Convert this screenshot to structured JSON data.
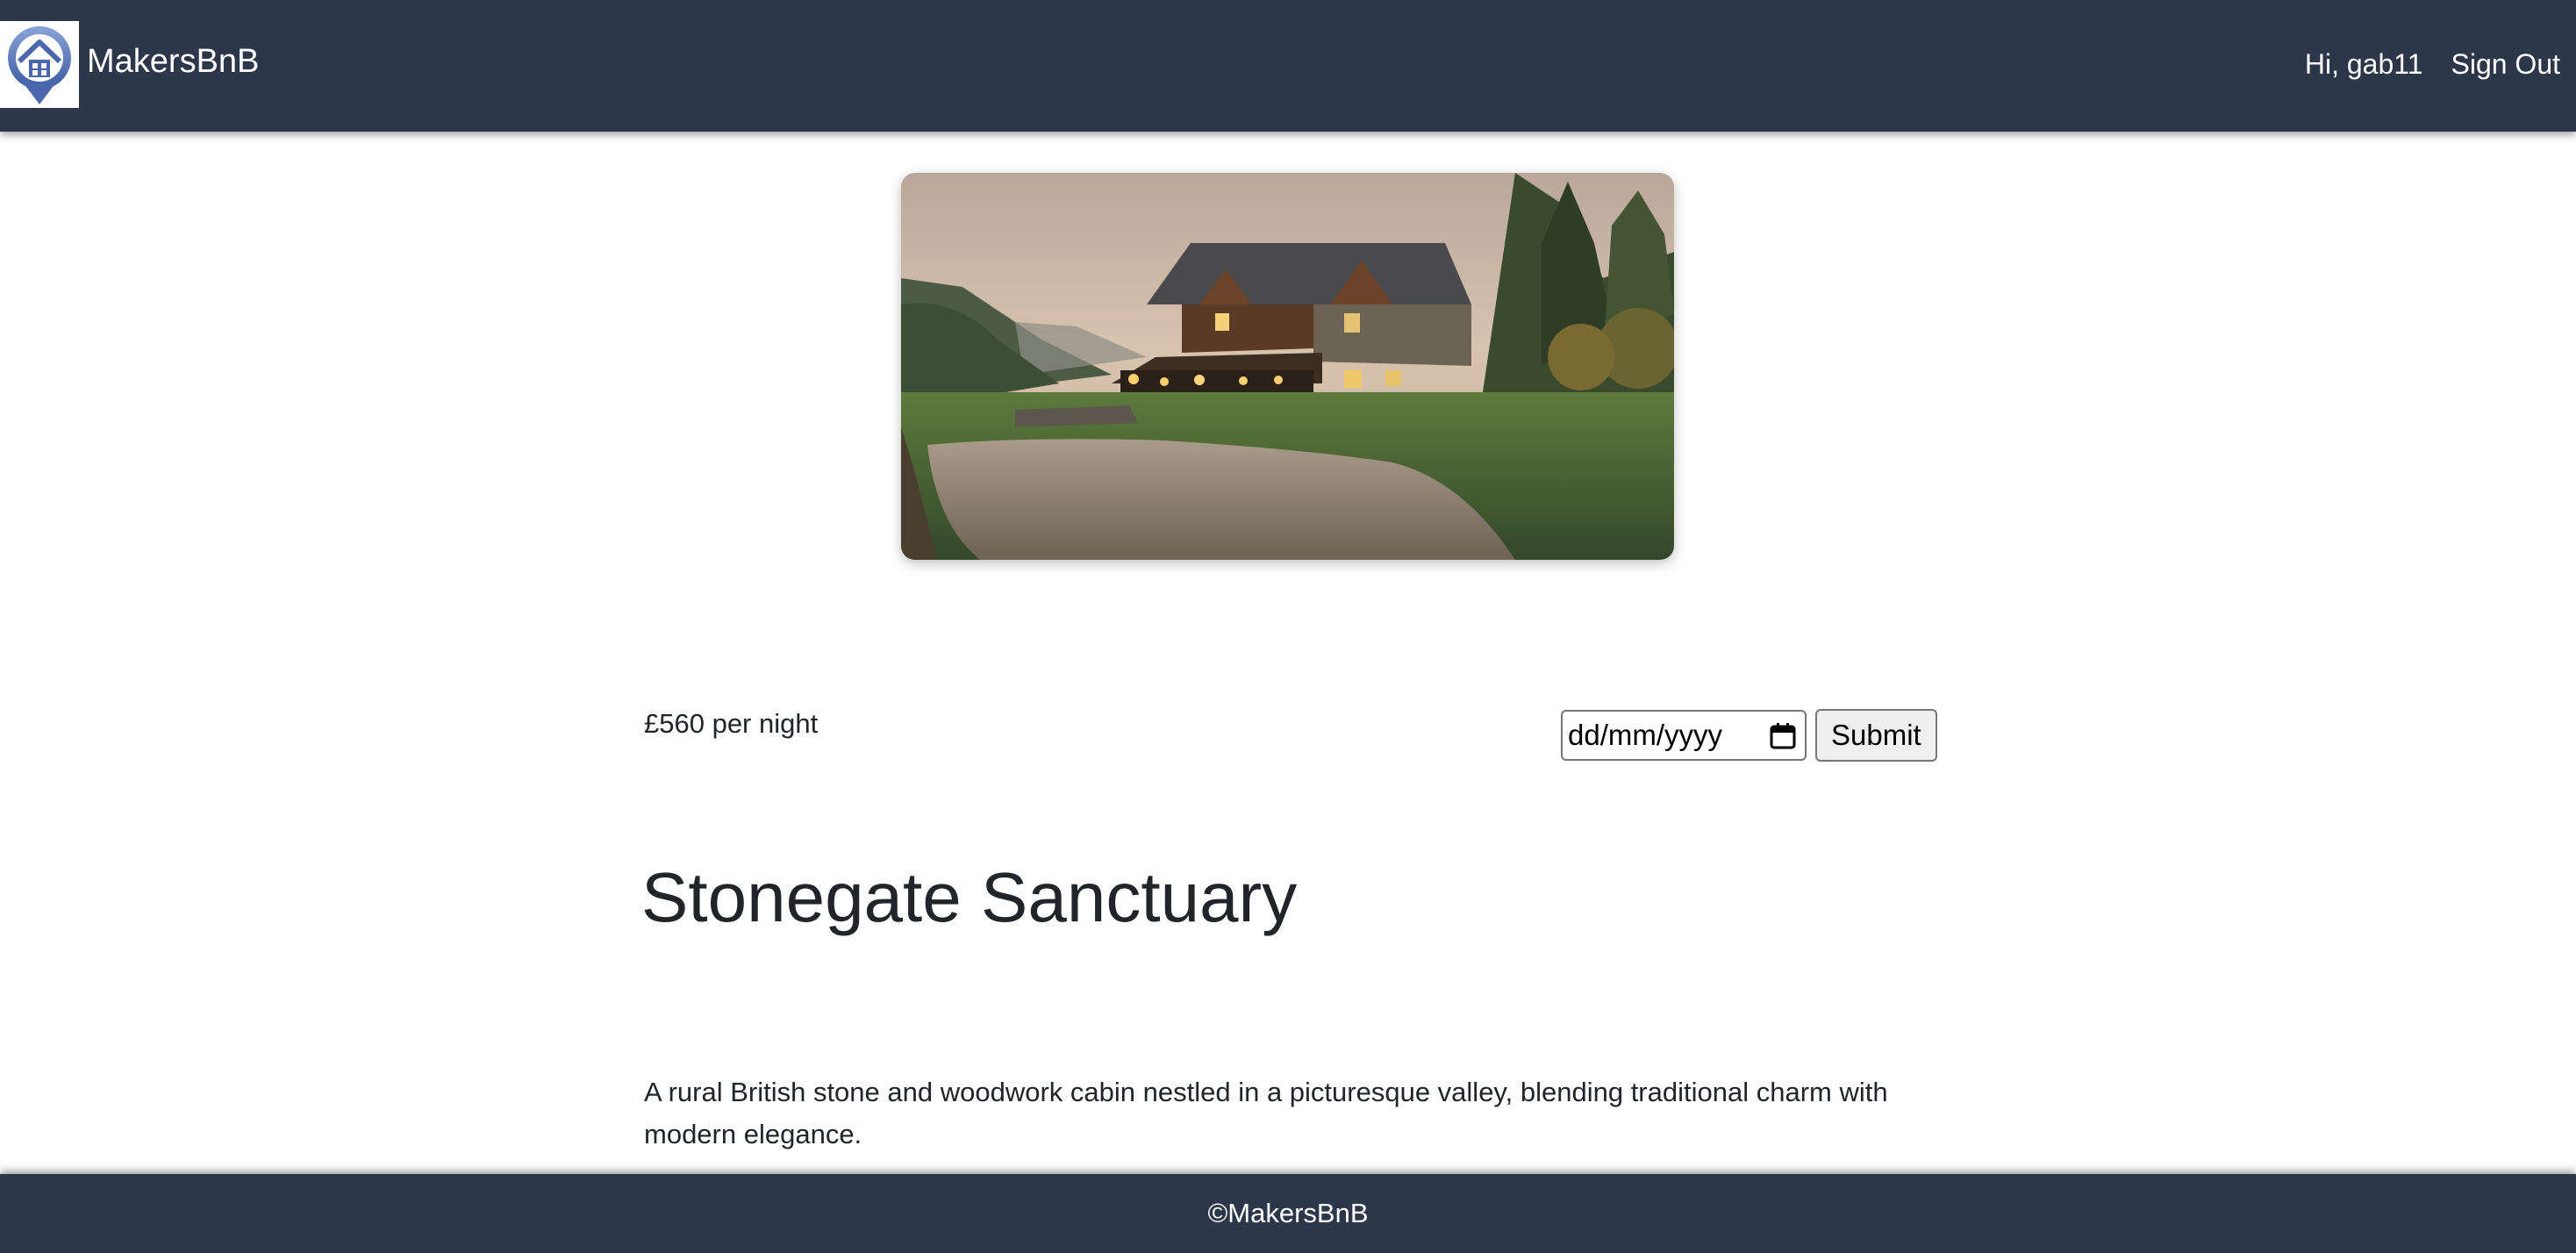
{
  "header": {
    "brand": "MakersBnB",
    "greeting": "Hi, gab11",
    "sign_out_label": "Sign Out"
  },
  "listing": {
    "price": "£560 per night",
    "date_placeholder": "dd/mm/yyyy",
    "submit_label": "Submit",
    "title": "Stonegate Sanctuary",
    "description": "A rural British stone and woodwork cabin nestled in a picturesque valley, blending traditional charm with modern elegance."
  },
  "footer": {
    "copyright": "©MakersBnB"
  },
  "colors": {
    "nav_background": "#2c374a",
    "logo_blue": "#5f7fbf"
  }
}
